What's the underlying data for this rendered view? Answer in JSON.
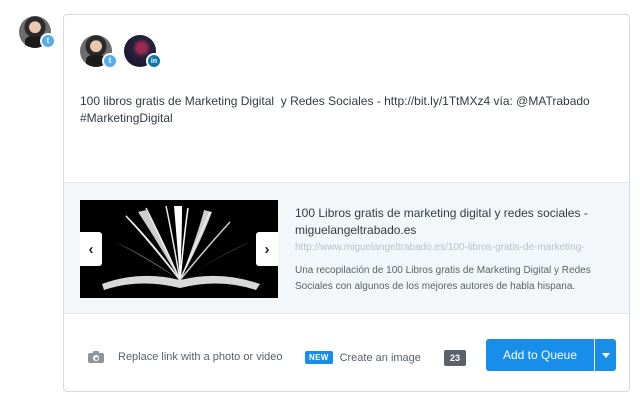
{
  "profile": {
    "avatar_icon": "user-avatar",
    "network_icon": "twitter-icon",
    "network_color": "#55acee"
  },
  "composer": {
    "selected_profiles": [
      {
        "avatar_icon": "user-avatar",
        "network": "twitter-icon",
        "network_glyph": "t"
      },
      {
        "avatar_icon": "user-avatar",
        "network": "linkedin-icon",
        "network_glyph": "in"
      }
    ],
    "text": "100 libros gratis de Marketing Digital  y Redes Sociales - http://bit.ly/1TtMXz4 vía: @MATrabado\n#MarketingDigital"
  },
  "attachment": {
    "prev_arrow": "‹",
    "next_arrow": "›",
    "thumbnail_icon": "open-book-image",
    "title": "100 Libros gratis de marketing digital y redes sociales - miguelangeltrabado.es",
    "url": "http://www.miguelangeltrabado.es/100-libros-gratis-de-marketing-",
    "description": "Una recopilación de 100 Libros gratis de Marketing Digital y Redes Sociales con algunos de los mejores autores de habla hispana."
  },
  "footer": {
    "replace_link_label": "Replace link with a photo or video",
    "new_badge": "NEW",
    "create_image_label": "Create an image",
    "char_count": "23",
    "add_to_queue_label": "Add to Queue"
  },
  "colors": {
    "accent": "#168eea",
    "twitter": "#55acee",
    "linkedin": "#0e76a8"
  }
}
